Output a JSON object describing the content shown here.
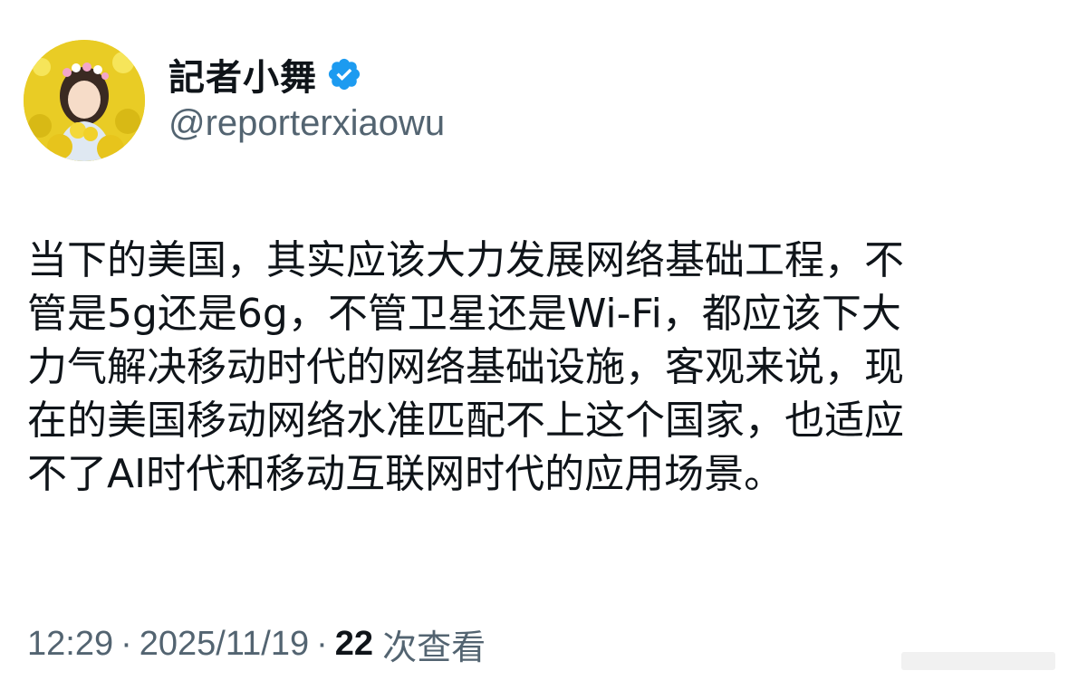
{
  "author": {
    "display_name": "記者小舞",
    "handle": "@reporterxiaowu",
    "verified": true,
    "verified_color": "#1d9bf0"
  },
  "tweet": {
    "lines": [
      "当下的美国，其实应该大力发展网络基础工程，不",
      "管是5g还是6g，不管卫星还是Wi-Fi，都应该下大",
      "力气解决移动时代的网络基础设施，客观来说，现",
      "在的美国移动网络水准匹配不上这个国家，也适应",
      "不了AI时代和移动互联网时代的应用场景。"
    ]
  },
  "meta": {
    "time": "12:29",
    "separator": "·",
    "date": "2025/11/19",
    "views_count": "22",
    "views_label": "次查看"
  },
  "icons": {
    "verified": "verified-badge-icon",
    "avatar": "avatar-image"
  },
  "colors": {
    "text": "#0f1419",
    "secondary": "#536471",
    "background": "#ffffff"
  }
}
